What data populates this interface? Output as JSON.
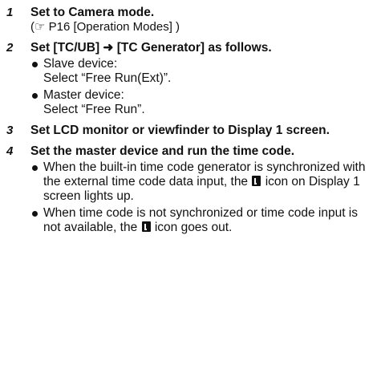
{
  "steps": [
    {
      "number": "1",
      "title": "Set to Camera mode.",
      "ref": "(☞ P16 [Operation Modes] )"
    },
    {
      "number": "2",
      "title": "Set [TC/UB] ➜ [TC Generator] as follows.",
      "bullets": [
        {
          "label": "Slave device:",
          "value": "Select “Free Run(Ext)”."
        },
        {
          "label": "Master device:",
          "value": "Select “Free Run”."
        }
      ]
    },
    {
      "number": "3",
      "title": "Set LCD monitor or viewfinder to Display 1 screen."
    },
    {
      "number": "4",
      "title": "Set the master device and run the time code.",
      "notes": [
        {
          "before": "When the built-in time code generator is synchronized with the external time code data input, the",
          "after": "icon on Display 1 screen lights up."
        },
        {
          "before": "When time code is not synchronized or time code input is not available, the",
          "after": "icon goes out."
        }
      ]
    }
  ]
}
